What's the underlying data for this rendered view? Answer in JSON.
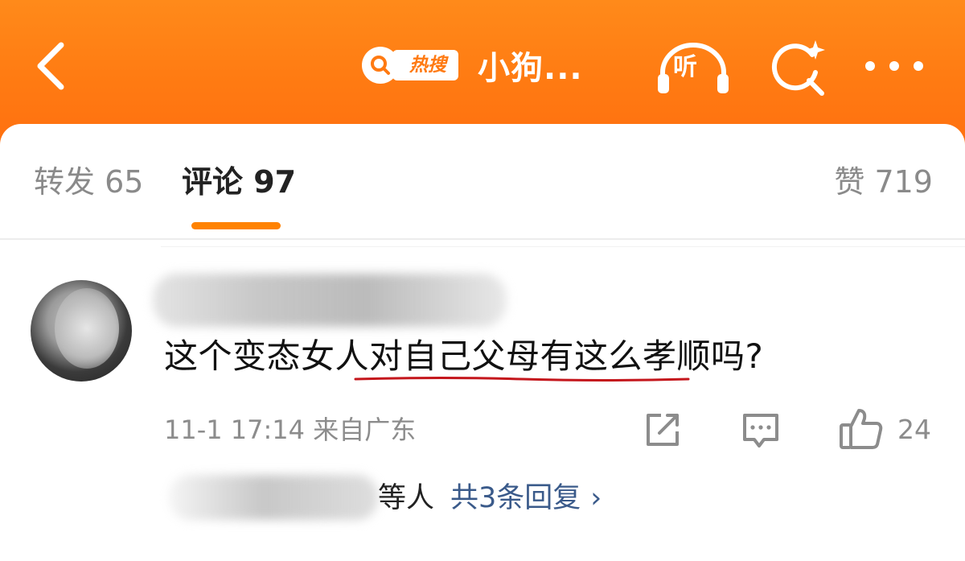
{
  "header": {
    "hot_badge": "热搜",
    "title": "小狗...",
    "listen_label": "听",
    "accent": "#ff7a12"
  },
  "tabs": [
    {
      "label": "转发 65",
      "active": false
    },
    {
      "label": "评论 97",
      "active": true
    },
    {
      "label": "赞 719",
      "active": false
    }
  ],
  "comment": {
    "text": "这个变态女人对自己父母有这么孝顺吗?",
    "meta": "11-1 17:14 来自广东",
    "likes": "24",
    "replies_suffix": "等人",
    "replies_total": "共3条回复",
    "replies_chevron": "›"
  },
  "icons": {
    "back": "back-arrow-icon",
    "search": "search-sparkle-icon",
    "more": "more-dots-icon",
    "listen": "headphones-icon",
    "share": "share-edit-icon",
    "reply": "comment-bubble-icon",
    "like": "thumbs-up-icon"
  },
  "colors": {
    "tab_underline": "#ff8200",
    "annotation_underline": "#c4161c",
    "link": "#3a5a8a"
  }
}
